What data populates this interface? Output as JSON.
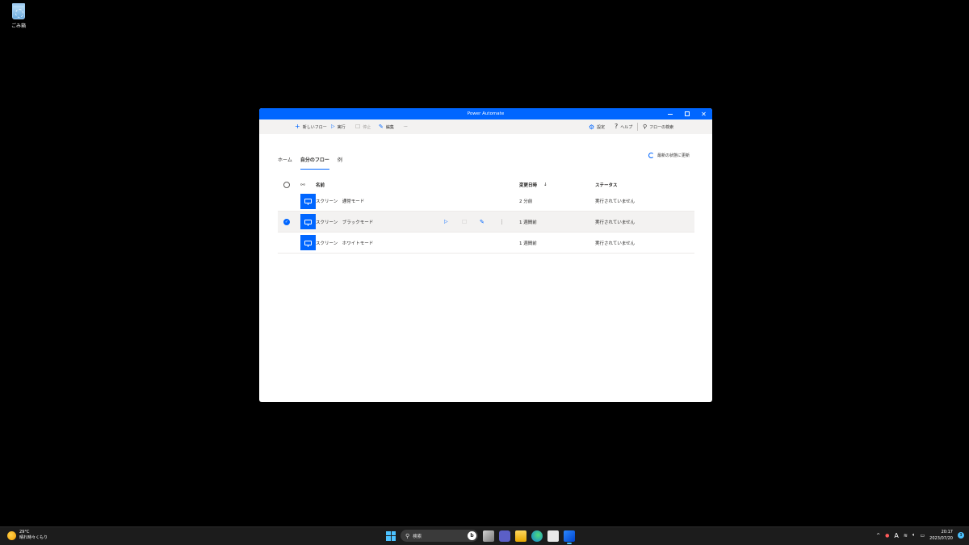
{
  "desktop": {
    "recycle_bin_label": "ごみ箱"
  },
  "window": {
    "title": "Power Automate"
  },
  "toolbar": {
    "new_flow": "新しいフロー",
    "run": "実行",
    "stop": "停止",
    "edit": "編集",
    "more": "···",
    "settings": "設定",
    "help": "ヘルプ",
    "search_placeholder": "フローの検索"
  },
  "tabs": [
    {
      "label": "ホーム",
      "active": false
    },
    {
      "label": "自分のフロー",
      "active": true
    },
    {
      "label": "例",
      "active": false
    }
  ],
  "refresh_label": "最新の状態に更新",
  "table": {
    "headers": {
      "name": "名前",
      "modified": "変更日時",
      "modified_sort": "↓",
      "status": "ステータス"
    },
    "rows": [
      {
        "name": "スクリーン　通常モード",
        "modified": "2 分前",
        "status": "実行されていません",
        "selected": false
      },
      {
        "name": "スクリーン　ブラックモード",
        "modified": "1 週間前",
        "status": "実行されていません",
        "selected": true
      },
      {
        "name": "スクリーン　ホワイトモード",
        "modified": "1 週間前",
        "status": "実行されていません",
        "selected": false
      }
    ]
  },
  "taskbar": {
    "weather_temp": "29°C",
    "weather_desc": "晴れ時々くもり",
    "search_label": "検索",
    "clock_time": "20:17",
    "clock_date": "2023/07/20",
    "ime_indicator": "A",
    "notification_count": "3"
  },
  "colors": {
    "accent": "#0066ff",
    "titlebar": "#0066ff",
    "taskbar": "#1c1c1c"
  }
}
